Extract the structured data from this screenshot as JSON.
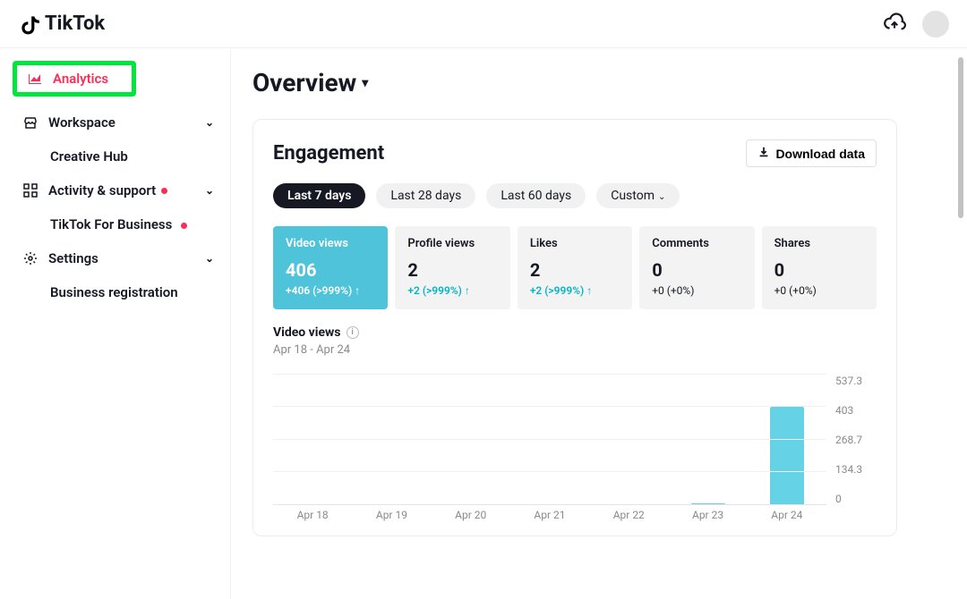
{
  "brand": "TikTok",
  "sidebar": {
    "analytics": "Analytics",
    "workspace": "Workspace",
    "creative_hub": "Creative Hub",
    "activity": "Activity & support",
    "tiktok_business": "TikTok For Business",
    "settings": "Settings",
    "business_reg": "Business registration"
  },
  "page": {
    "title": "Overview"
  },
  "engagement": {
    "title": "Engagement",
    "download": "Download data",
    "ranges": {
      "d7": "Last 7 days",
      "d28": "Last 28 days",
      "d60": "Last 60 days",
      "custom": "Custom"
    },
    "metrics": {
      "video_views": {
        "label": "Video views",
        "value": "406",
        "delta": "+406 (>999%)"
      },
      "profile_views": {
        "label": "Profile views",
        "value": "2",
        "delta": "+2 (>999%)"
      },
      "likes": {
        "label": "Likes",
        "value": "2",
        "delta": "+2 (>999%)"
      },
      "comments": {
        "label": "Comments",
        "value": "0",
        "delta": "+0 (+0%)"
      },
      "shares": {
        "label": "Shares",
        "value": "0",
        "delta": "+0 (+0%)"
      }
    },
    "chart": {
      "title": "Video views",
      "subtitle": "Apr 18 - Apr 24"
    }
  },
  "chart_data": {
    "type": "bar",
    "title": "Video views",
    "xlabel": "",
    "ylabel": "",
    "ylim": [
      0,
      537.3
    ],
    "y_ticks": [
      0,
      134.3,
      268.7,
      403,
      537.3
    ],
    "categories": [
      "Apr 18",
      "Apr 19",
      "Apr 20",
      "Apr 21",
      "Apr 22",
      "Apr 23",
      "Apr 24"
    ],
    "values": [
      0,
      0,
      0,
      0,
      0,
      3,
      403
    ]
  }
}
